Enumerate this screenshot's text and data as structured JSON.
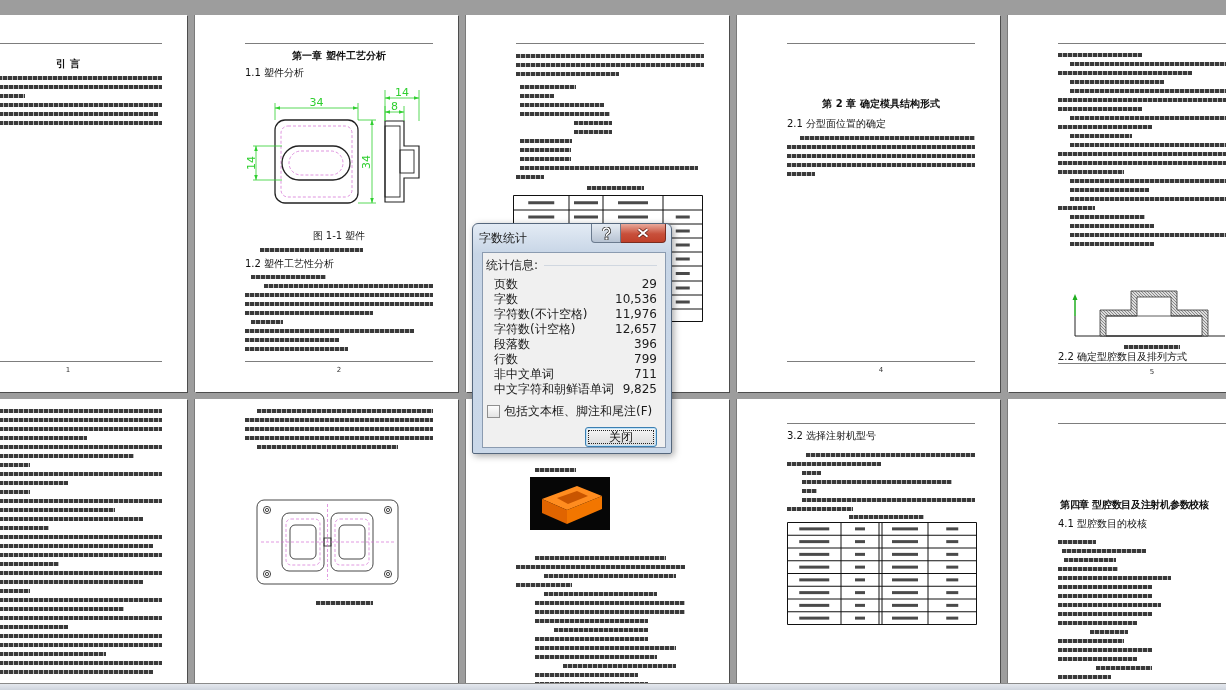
{
  "document_pages": {
    "top_row": {
      "page_1": {
        "heading": "引 言",
        "page_number": "1"
      },
      "page_2": {
        "chapter_title": "第一章 塑件工艺分析",
        "section_title": "1.1 塑件分析",
        "drawing": {
          "width_label": "34",
          "slot_label": "14",
          "height_label": "34",
          "side_width_label": "14",
          "side_step_label": "8"
        },
        "caption": "图 1-1 塑件",
        "section_2_title": "1.2 塑件工艺性分析",
        "page_number": "2"
      },
      "page_4": {
        "chapter_title": "第 2 章 确定模具结构形式",
        "section_title": "2.1 分型面位置的确定",
        "page_number": "4"
      },
      "page_5": {
        "section_title": "2.2 确定型腔数目及排列方式",
        "page_number": "5"
      }
    },
    "bottom_row": {
      "page_4": {
        "section_title": "3.2 选择注射机型号"
      },
      "page_5": {
        "chapter_title": "第四章 型腔数目及注射机参数校核",
        "section_title": "4.1 型腔数目的校核"
      }
    }
  },
  "word_count_dialog": {
    "title": "字数统计",
    "group_label": "统计信息:",
    "stats": [
      {
        "label": "页数",
        "value": "29"
      },
      {
        "label": "字数",
        "value": "10,536"
      },
      {
        "label": "字符数(不计空格)",
        "value": "11,976"
      },
      {
        "label": "字符数(计空格)",
        "value": "12,657"
      },
      {
        "label": "段落数",
        "value": "396"
      },
      {
        "label": "行数",
        "value": "799"
      },
      {
        "label": "非中文单词",
        "value": "711"
      },
      {
        "label": "中文字符和朝鲜语单词",
        "value": "9,825"
      }
    ],
    "include_option": {
      "label": "包括文本框、脚注和尾注(F)",
      "checked": false
    },
    "close_button": "关闭"
  }
}
